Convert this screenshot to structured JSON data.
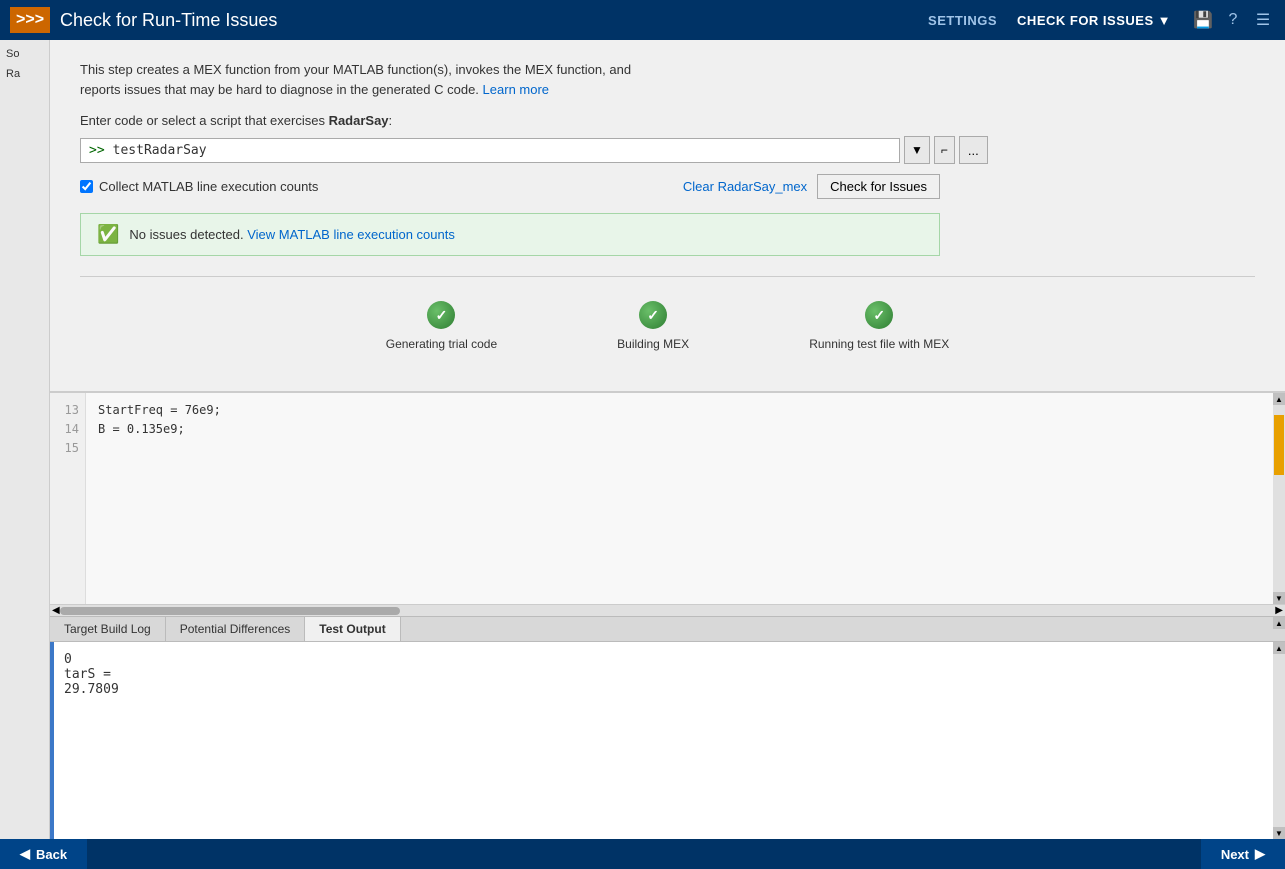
{
  "header": {
    "logo_text": ">>>",
    "title": "Check for Run-Time Issues",
    "nav_settings": "SETTINGS",
    "nav_check": "CHECK FOR ISSUES",
    "nav_check_arrow": "▼",
    "icon_save": "💾",
    "icon_help": "?",
    "icon_menu": "☰"
  },
  "sidebar": {
    "item1": "So",
    "item2": "Ra"
  },
  "main": {
    "description_line1": "This step creates a MEX function from your MATLAB function(s), invokes the MEX function, and",
    "description_line2": "reports issues that may be hard to diagnose in the generated C code.",
    "learn_more": "Learn more",
    "enter_code_prefix": "Enter code or select a script that exercises ",
    "enter_code_bold": "RadarSay",
    "enter_code_suffix": ":",
    "code_prompt": ">>",
    "code_value": "testRadarSay",
    "dropdown_arrow": "▼",
    "expand_icon": "⌐",
    "ellipsis_icon": "...",
    "checkbox_label": "Collect MATLAB line execution counts",
    "clear_link": "Clear RadarSay_mex",
    "check_issues_btn": "Check for Issues",
    "success_text": "No issues detected.",
    "success_link": "View MATLAB line execution counts",
    "step1_label": "Generating trial code",
    "step2_label": "Building MEX",
    "step3_label": "Running test file with MEX"
  },
  "editor": {
    "line13": "13",
    "line14": "14",
    "line15": "15",
    "code13": "",
    "code14": "StartFreq = 76e9;",
    "code15": "B = 0.135e9;"
  },
  "tabs": {
    "tab1": "Target Build Log",
    "tab2": "Potential Differences",
    "tab3": "Test Output"
  },
  "output": {
    "line1": "0",
    "line2": "",
    "line3": "tarS =",
    "line4": "",
    "line5": "    29.7809"
  },
  "footer": {
    "back": "Back",
    "back_arrow": "◀",
    "next": "Next",
    "next_arrow": "▶"
  }
}
